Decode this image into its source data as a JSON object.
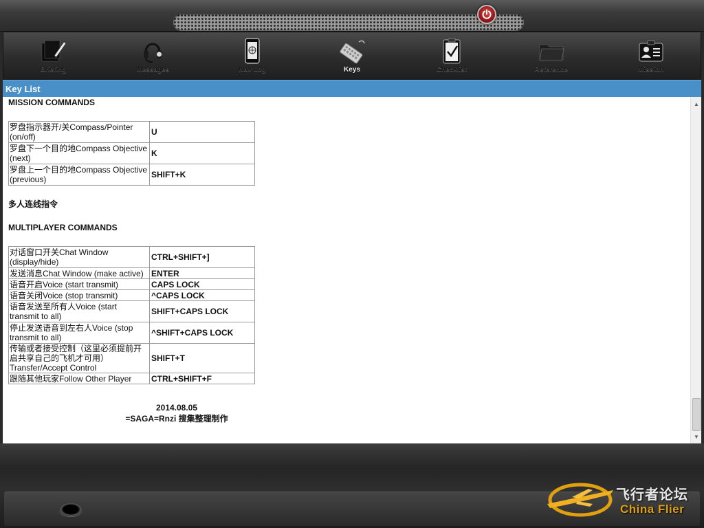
{
  "tabs": [
    {
      "label": "Briefing",
      "icon": "briefing-icon"
    },
    {
      "label": "Messages",
      "icon": "headset-icon"
    },
    {
      "label": "Nav Log",
      "icon": "nav-log-icon"
    },
    {
      "label": "Keys",
      "icon": "keyboard-icon",
      "active": true
    },
    {
      "label": "Checklist",
      "icon": "checklist-icon"
    },
    {
      "label": "Reference",
      "icon": "folder-icon"
    },
    {
      "label": "Mission",
      "icon": "mission-icon"
    }
  ],
  "header": {
    "title": "Key List"
  },
  "mission": {
    "heading": "MISSION COMMANDS",
    "rows": [
      {
        "command": "罗盘指示器开/关Compass/Pointer (on/off)",
        "key": "U"
      },
      {
        "command": "罗盘下一个目的地Compass Objective (next)",
        "key": "K"
      },
      {
        "command": "罗盘上一个目的地Compass Objective (previous)",
        "key": "SHIFT+K"
      }
    ]
  },
  "multiplayer": {
    "heading_cn": "多人连线指令",
    "heading": "MULTIPLAYER COMMANDS",
    "rows": [
      {
        "command": "对话窗口开关Chat Window (display/hide)",
        "key": "CTRL+SHIFT+]"
      },
      {
        "command": "发送消息Chat Window (make active)",
        "key": "ENTER"
      },
      {
        "command": "语音开启Voice (start transmit)",
        "key": "CAPS LOCK"
      },
      {
        "command": "语音关闭Voice (stop transmit)",
        "key": "^CAPS LOCK"
      },
      {
        "command": "语音发送至所有人Voice (start transmit to all)",
        "key": "SHIFT+CAPS LOCK"
      },
      {
        "command": "停止发送语音到左右人Voice (stop transmit to all)",
        "key": "^SHIFT+CAPS LOCK"
      },
      {
        "command": "传输或者接受控制（这里必须提前开启共享自己的飞机才可用）Transfer/Accept Control",
        "key": "SHIFT+T"
      },
      {
        "command": "跟随其他玩家Follow Other Player",
        "key": "CTRL+SHIFT+F"
      }
    ]
  },
  "footer": {
    "date": "2014.08.05",
    "credit": "=SAGA=Rnzi 搜集整理制作"
  },
  "watermark": {
    "cn": "飞行者论坛",
    "en": "China Flier"
  },
  "colors": {
    "header_bg": "#4a90c8",
    "power": "#c02020",
    "watermark_gold": "#e0a010"
  }
}
